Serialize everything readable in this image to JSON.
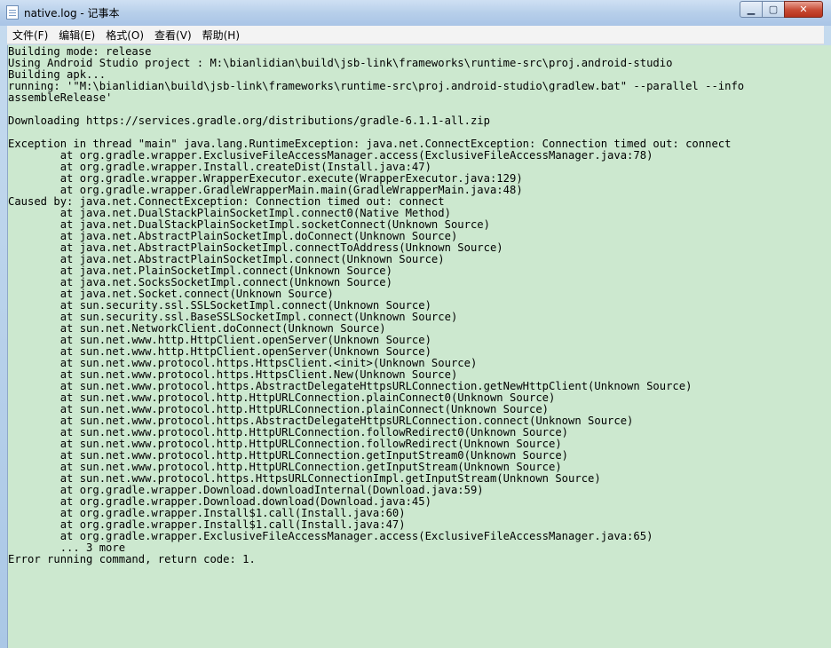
{
  "window": {
    "title": "native.log - 记事本",
    "caption_buttons": {
      "minimize": "▁",
      "maximize": "▢",
      "close": "✕"
    }
  },
  "menu": {
    "items": [
      {
        "label": "文件(F)"
      },
      {
        "label": "编辑(E)"
      },
      {
        "label": "格式(O)"
      },
      {
        "label": "查看(V)"
      },
      {
        "label": "帮助(H)"
      }
    ]
  },
  "editor": {
    "background_color": "#cce8cf",
    "lines": [
      "Building mode: release",
      "Using Android Studio project : M:\\bianlidian\\build\\jsb-link\\frameworks\\runtime-src\\proj.android-studio",
      "Building apk...",
      "running: '\"M:\\bianlidian\\build\\jsb-link\\frameworks\\runtime-src\\proj.android-studio\\gradlew.bat\" --parallel --info",
      "assembleRelease'",
      "",
      "Downloading https://services.gradle.org/distributions/gradle-6.1.1-all.zip",
      "",
      "Exception in thread \"main\" java.lang.RuntimeException: java.net.ConnectException: Connection timed out: connect",
      "        at org.gradle.wrapper.ExclusiveFileAccessManager.access(ExclusiveFileAccessManager.java:78)",
      "        at org.gradle.wrapper.Install.createDist(Install.java:47)",
      "        at org.gradle.wrapper.WrapperExecutor.execute(WrapperExecutor.java:129)",
      "        at org.gradle.wrapper.GradleWrapperMain.main(GradleWrapperMain.java:48)",
      "Caused by: java.net.ConnectException: Connection timed out: connect",
      "        at java.net.DualStackPlainSocketImpl.connect0(Native Method)",
      "        at java.net.DualStackPlainSocketImpl.socketConnect(Unknown Source)",
      "        at java.net.AbstractPlainSocketImpl.doConnect(Unknown Source)",
      "        at java.net.AbstractPlainSocketImpl.connectToAddress(Unknown Source)",
      "        at java.net.AbstractPlainSocketImpl.connect(Unknown Source)",
      "        at java.net.PlainSocketImpl.connect(Unknown Source)",
      "        at java.net.SocksSocketImpl.connect(Unknown Source)",
      "        at java.net.Socket.connect(Unknown Source)",
      "        at sun.security.ssl.SSLSocketImpl.connect(Unknown Source)",
      "        at sun.security.ssl.BaseSSLSocketImpl.connect(Unknown Source)",
      "        at sun.net.NetworkClient.doConnect(Unknown Source)",
      "        at sun.net.www.http.HttpClient.openServer(Unknown Source)",
      "        at sun.net.www.http.HttpClient.openServer(Unknown Source)",
      "        at sun.net.www.protocol.https.HttpsClient.<init>(Unknown Source)",
      "        at sun.net.www.protocol.https.HttpsClient.New(Unknown Source)",
      "        at sun.net.www.protocol.https.AbstractDelegateHttpsURLConnection.getNewHttpClient(Unknown Source)",
      "        at sun.net.www.protocol.http.HttpURLConnection.plainConnect0(Unknown Source)",
      "        at sun.net.www.protocol.http.HttpURLConnection.plainConnect(Unknown Source)",
      "        at sun.net.www.protocol.https.AbstractDelegateHttpsURLConnection.connect(Unknown Source)",
      "        at sun.net.www.protocol.http.HttpURLConnection.followRedirect0(Unknown Source)",
      "        at sun.net.www.protocol.http.HttpURLConnection.followRedirect(Unknown Source)",
      "        at sun.net.www.protocol.http.HttpURLConnection.getInputStream0(Unknown Source)",
      "        at sun.net.www.protocol.http.HttpURLConnection.getInputStream(Unknown Source)",
      "        at sun.net.www.protocol.https.HttpsURLConnectionImpl.getInputStream(Unknown Source)",
      "        at org.gradle.wrapper.Download.downloadInternal(Download.java:59)",
      "        at org.gradle.wrapper.Download.download(Download.java:45)",
      "        at org.gradle.wrapper.Install$1.call(Install.java:60)",
      "        at org.gradle.wrapper.Install$1.call(Install.java:47)",
      "        at org.gradle.wrapper.ExclusiveFileAccessManager.access(ExclusiveFileAccessManager.java:65)",
      "        ... 3 more",
      "Error running command, return code: 1."
    ]
  }
}
